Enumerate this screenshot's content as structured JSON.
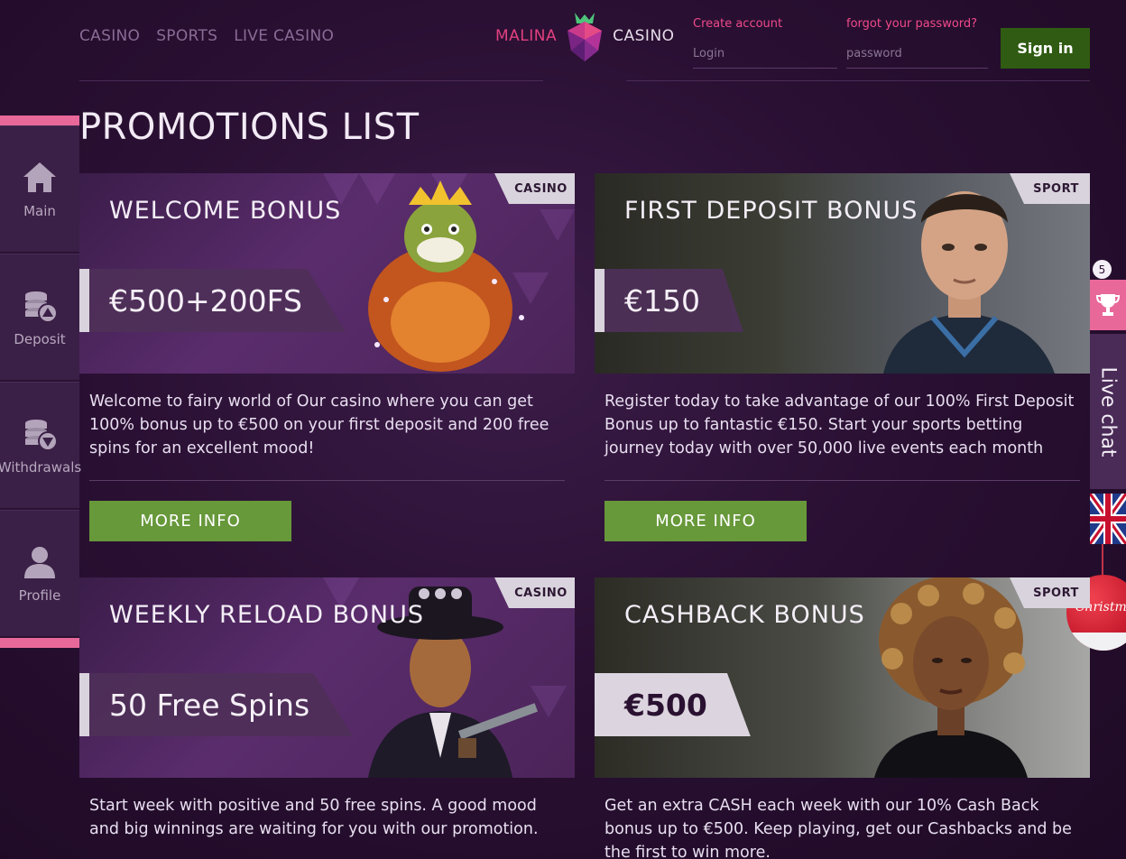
{
  "nav": {
    "items": [
      "CASINO",
      "SPORTS",
      "LIVE CASINO"
    ]
  },
  "logo": {
    "left": "MALINA",
    "right": "CASINO"
  },
  "auth": {
    "create_account": "Create account",
    "forgot_password": "forgot your password?",
    "login_placeholder": "Login",
    "password_placeholder": "password",
    "signin_label": "Sign in"
  },
  "page_title": "PROMOTIONS LIST",
  "sidebar": {
    "items": [
      {
        "label": "Main",
        "icon": "home-icon"
      },
      {
        "label": "Deposit",
        "icon": "coins-up-icon"
      },
      {
        "label": "Withdrawals",
        "icon": "coins-down-icon"
      },
      {
        "label": "Profile",
        "icon": "user-icon"
      }
    ]
  },
  "promos": [
    {
      "title": "WELCOME BONUS",
      "tag": "CASINO",
      "amount": "€500+200FS",
      "description": "Welcome to fairy world of Our casino where you can get 100% bonus up to €500 on your first deposit and 200 free spins for an excellent mood!",
      "button": "MORE INFO"
    },
    {
      "title": "FIRST DEPOSIT BONUS",
      "tag": "SPORT",
      "amount": "€150",
      "description": "Register today to take advantage of our 100% First Deposit Bonus up to fantastic €150. Start your sports betting journey today with over 50,000 live events each month",
      "button": "MORE INFO"
    },
    {
      "title": "WEEKLY RELOAD BONUS",
      "tag": "CASINO",
      "amount": "50 Free Spins",
      "description": "Start week with positive and 50 free spins. A good mood and big winnings are waiting for you with our promotion."
    },
    {
      "title": "CASHBACK BONUS",
      "tag": "SPORT",
      "amount": "€500",
      "description": "Get an extra CASH each week with our 10% Cash Back bonus up to €500. Keep playing, get our Cashbacks and be the first to win more."
    }
  ],
  "right_rail": {
    "trophy_count": "5",
    "live_chat": "Live chat",
    "ornament_text": "Christmas"
  },
  "colors": {
    "accent_pink": "#e8689a",
    "brand_pink": "#e2407f",
    "signin_green": "#2f5b12",
    "button_green": "#67983a",
    "background": "#2a1033"
  }
}
